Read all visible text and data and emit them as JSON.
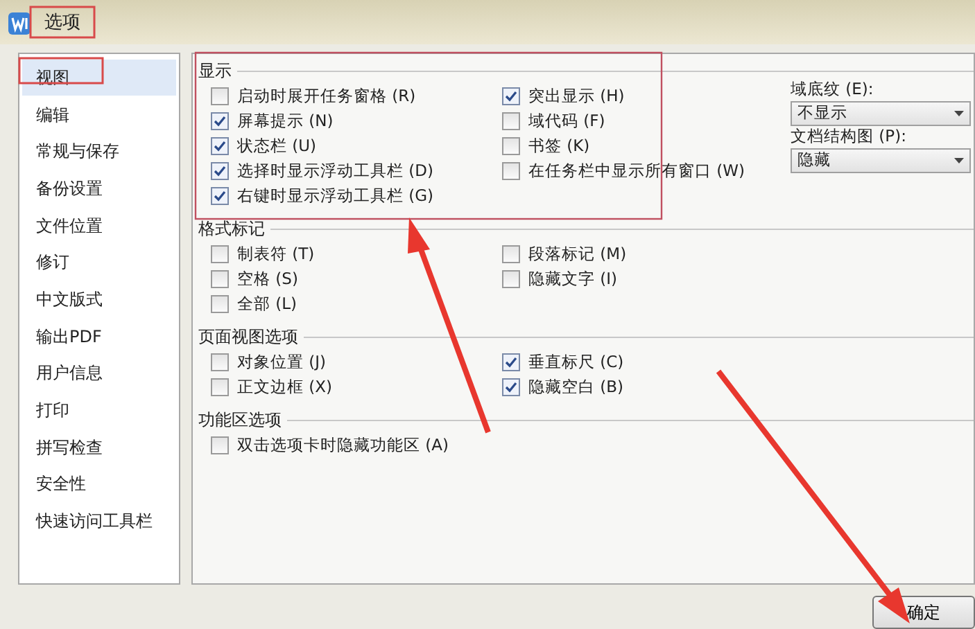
{
  "window": {
    "title": "选项"
  },
  "sidebar": {
    "items": [
      {
        "label": "视图",
        "selected": true
      },
      {
        "label": "编辑",
        "selected": false
      },
      {
        "label": "常规与保存",
        "selected": false
      },
      {
        "label": "备份设置",
        "selected": false
      },
      {
        "label": "文件位置",
        "selected": false
      },
      {
        "label": "修订",
        "selected": false
      },
      {
        "label": "中文版式",
        "selected": false
      },
      {
        "label": "输出PDF",
        "selected": false
      },
      {
        "label": "用户信息",
        "selected": false
      },
      {
        "label": "打印",
        "selected": false
      },
      {
        "label": "拼写检查",
        "selected": false
      },
      {
        "label": "安全性",
        "selected": false
      },
      {
        "label": "快速访问工具栏",
        "selected": false
      }
    ]
  },
  "sections": [
    {
      "title": "显示",
      "columns": [
        [
          {
            "label": "启动时展开任务窗格 (R)",
            "checked": false
          },
          {
            "label": "屏幕提示 (N)",
            "checked": true
          },
          {
            "label": "状态栏 (U)",
            "checked": true
          },
          {
            "label": "选择时显示浮动工具栏 (D)",
            "checked": true
          },
          {
            "label": "右键时显示浮动工具栏 (G)",
            "checked": true
          }
        ],
        [
          {
            "label": "突出显示 (H)",
            "checked": true
          },
          {
            "label": "域代码 (F)",
            "checked": false
          },
          {
            "label": "书签 (K)",
            "checked": false
          },
          {
            "label": "在任务栏中显示所有窗口 (W)",
            "checked": false
          }
        ]
      ],
      "dropdowns": [
        {
          "label": "域底纹 (E):",
          "value": "不显示"
        },
        {
          "label": "文档结构图 (P):",
          "value": "隐藏"
        }
      ]
    },
    {
      "title": "格式标记",
      "columns": [
        [
          {
            "label": "制表符 (T)",
            "checked": false
          },
          {
            "label": "空格 (S)",
            "checked": false
          },
          {
            "label": "全部 (L)",
            "checked": false
          }
        ],
        [
          {
            "label": "段落标记 (M)",
            "checked": false
          },
          {
            "label": "隐藏文字 (I)",
            "checked": false
          }
        ]
      ]
    },
    {
      "title": "页面视图选项",
      "columns": [
        [
          {
            "label": "对象位置 (J)",
            "checked": false
          },
          {
            "label": "正文边框 (X)",
            "checked": false
          }
        ],
        [
          {
            "label": "垂直标尺 (C)",
            "checked": true
          },
          {
            "label": "隐藏空白 (B)",
            "checked": true
          }
        ]
      ]
    },
    {
      "title": "功能区选项",
      "columns": [
        [
          {
            "label": "双击选项卡时隐藏功能区 (A)",
            "checked": false
          }
        ]
      ]
    }
  ],
  "buttons": [
    "确定"
  ]
}
